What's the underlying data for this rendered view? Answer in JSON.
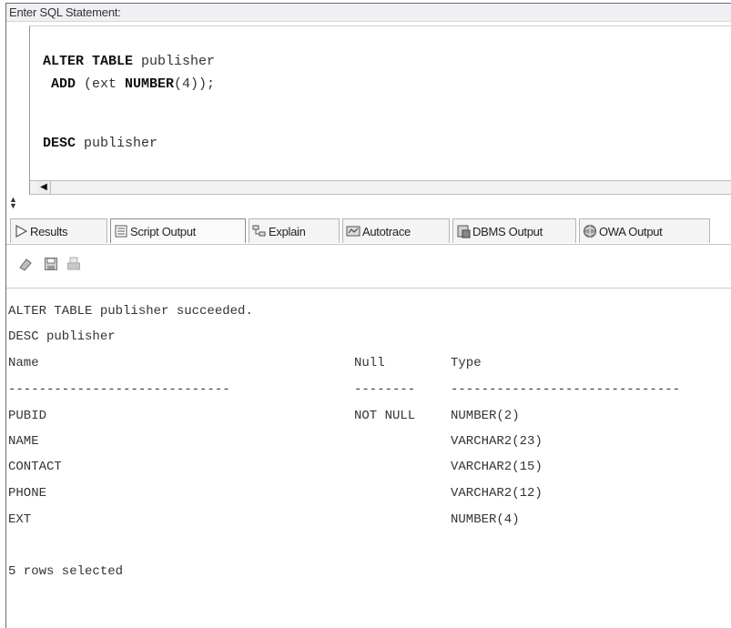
{
  "editor_label": "Enter SQL Statement:",
  "sql": {
    "line1": {
      "kw": "ALTER TABLE",
      "rest": " publisher"
    },
    "line2": {
      "kw1": "ADD",
      "mid": " (ext ",
      "kw2": "NUMBER",
      "rest": "(4));"
    },
    "line3": {
      "kw": "DESC",
      "rest": " publisher"
    }
  },
  "tabs": [
    "Results",
    "Script Output",
    "Explain",
    "Autotrace",
    "DBMS Output",
    "OWA Output"
  ],
  "active_tab": "Script Output",
  "icons": {
    "results": "play-triangle-icon",
    "script_output": "script-document-icon",
    "explain": "explain-plan-icon",
    "autotrace": "autotrace-icon",
    "dbms_output": "dbms-output-icon",
    "owa_output": "owa-globe-icon",
    "clear": "eraser-icon",
    "save": "save-disk-icon",
    "print": "print-icon"
  },
  "output": {
    "line1": "ALTER TABLE publisher succeeded.",
    "line2": "DESC publisher",
    "header": {
      "name": "Name",
      "null": "Null",
      "type": "Type"
    },
    "sep": {
      "name": "-----------------------------",
      "null": "--------",
      "type": "------------------------------"
    },
    "rows": [
      {
        "name": "PUBID",
        "null": "NOT NULL",
        "type": "NUMBER(2)"
      },
      {
        "name": "NAME",
        "null": "",
        "type": "VARCHAR2(23)"
      },
      {
        "name": "CONTACT",
        "null": "",
        "type": "VARCHAR2(15)"
      },
      {
        "name": "PHONE",
        "null": "",
        "type": "VARCHAR2(12)"
      },
      {
        "name": "EXT",
        "null": "",
        "type": "NUMBER(4)"
      }
    ],
    "footer": "5 rows selected"
  }
}
